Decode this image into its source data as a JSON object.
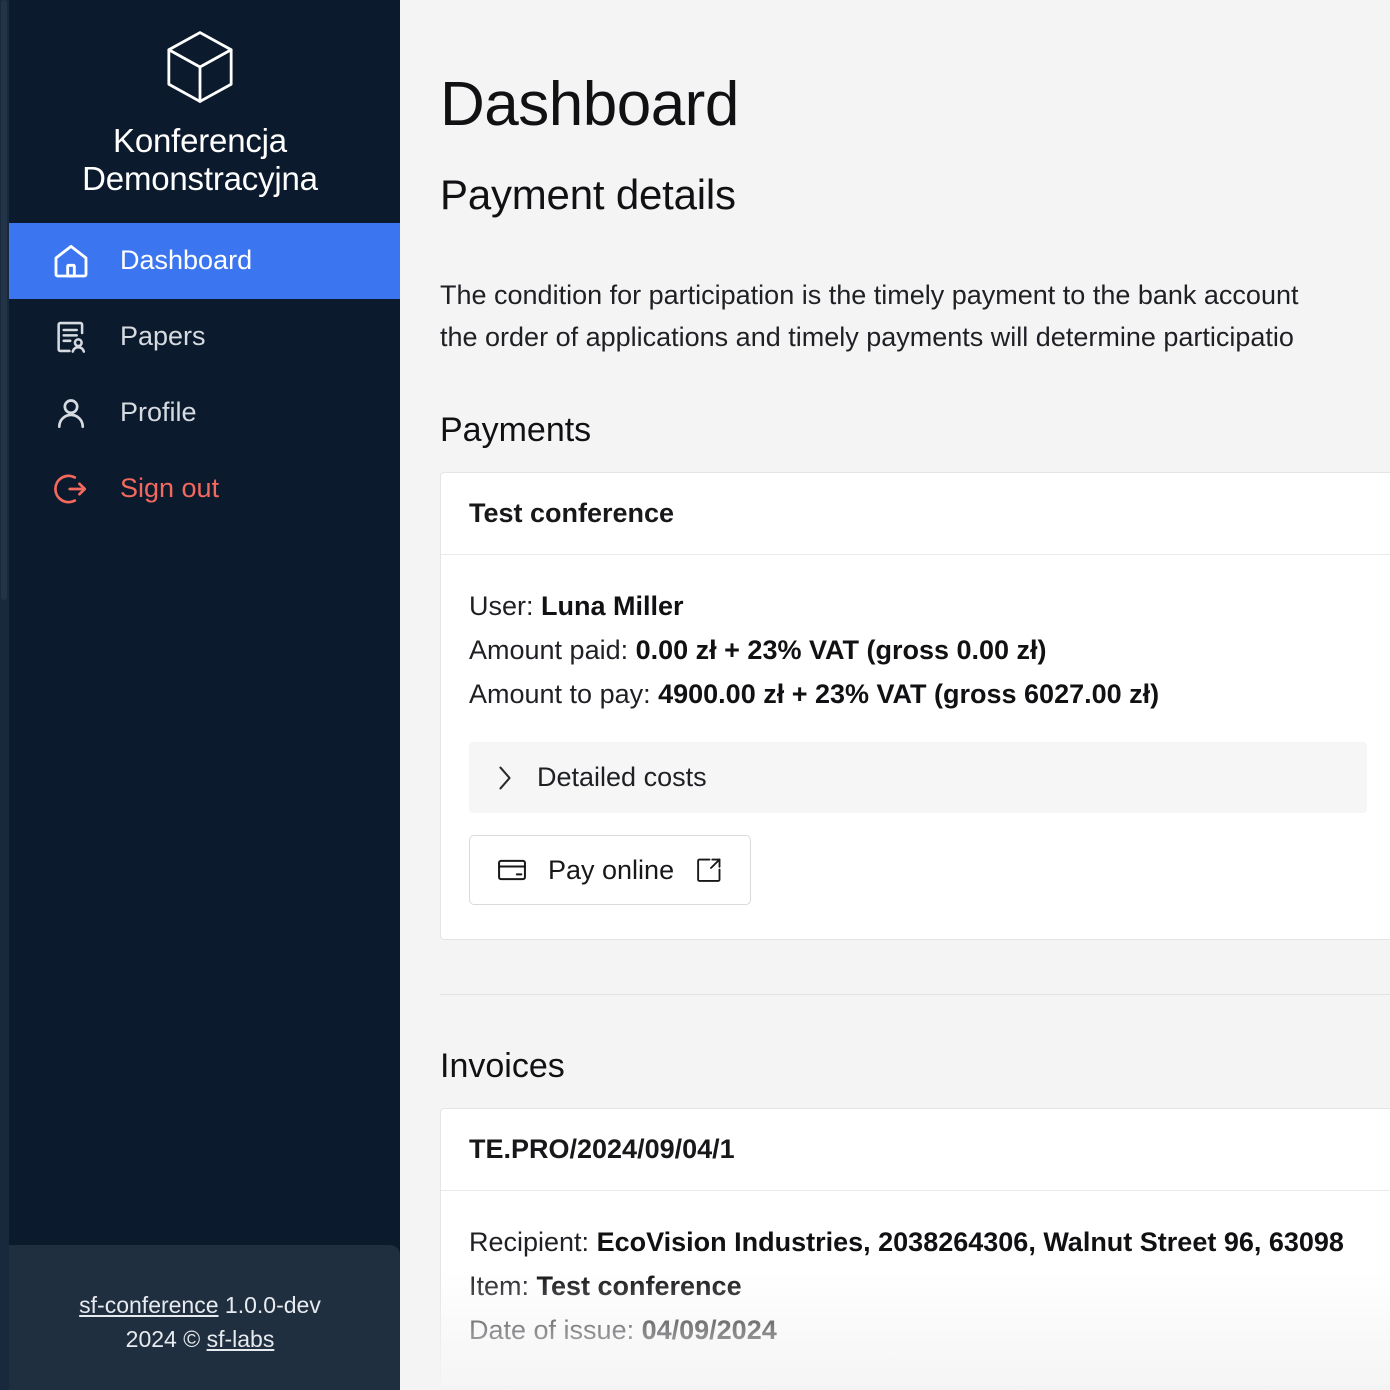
{
  "sidebar": {
    "brand": {
      "logo_icon": "cube-icon",
      "title": "Konferencja Demonstracyjna"
    },
    "items": [
      {
        "label": "Dashboard",
        "icon": "home-icon",
        "active": true
      },
      {
        "label": "Papers",
        "icon": "document-user-icon",
        "active": false
      },
      {
        "label": "Profile",
        "icon": "user-icon",
        "active": false
      },
      {
        "label": "Sign out",
        "icon": "logout-icon",
        "active": false
      }
    ],
    "footer": {
      "app_link": "sf-conference",
      "version": "1.0.0-dev",
      "copyright": "2024 ©",
      "vendor_link": "sf-labs"
    }
  },
  "main": {
    "page_title": "Dashboard",
    "section_title": "Payment details",
    "intro_line_1": "The condition for participation is the timely payment to the bank account",
    "intro_line_2": "the order of applications and timely payments will determine participatio",
    "payments": {
      "heading": "Payments",
      "card_title": "Test conference",
      "user_label": "User: ",
      "user_value": "Luna Miller",
      "paid_label": "Amount paid: ",
      "paid_value": "0.00 zł + 23% VAT (gross 0.00 zł)",
      "topay_label": "Amount to pay: ",
      "topay_value": "4900.00 zł + 23% VAT (gross 6027.00 zł)",
      "accordion_label": "Detailed costs",
      "accordion_icon": "chevron-right-icon",
      "pay_button_label": "Pay online",
      "pay_button_icon": "credit-card-icon",
      "pay_button_external_icon": "external-link-icon"
    },
    "invoices": {
      "heading": "Invoices",
      "card_title": "TE.PRO/2024/09/04/1",
      "recipient_label": "Recipient: ",
      "recipient_value": "EcoVision Industries, 2038264306, Walnut Street 96, 63098",
      "item_label": "Item: ",
      "item_value": "Test conference",
      "date_label": "Date of issue: ",
      "date_value": "04/09/2024"
    }
  },
  "colors": {
    "sidebar_bg": "#0b1a2c",
    "sidebar_footer_bg": "#202f40",
    "accent_blue": "#3b76f0",
    "danger_red": "#f4695e",
    "page_bg": "#f4f4f5",
    "card_bg": "#ffffff",
    "border": "#e4e4e7"
  }
}
